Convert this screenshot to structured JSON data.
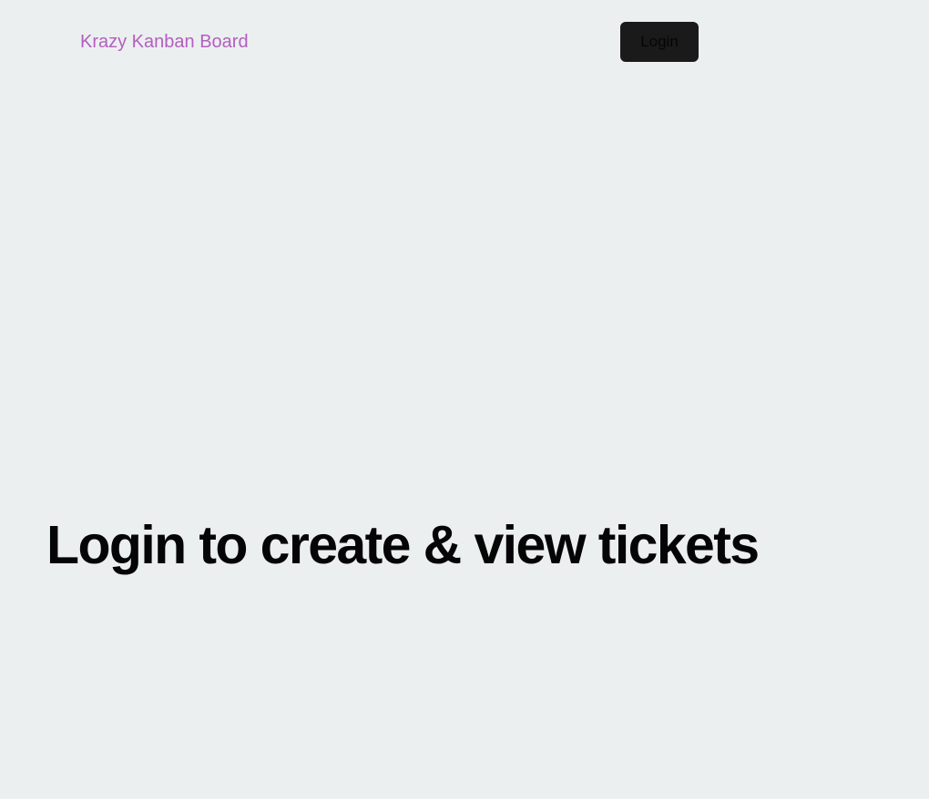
{
  "nav": {
    "brand": "Krazy Kanban Board",
    "login_label": "Login"
  },
  "main": {
    "heading": "Login to create & view tickets"
  },
  "colors": {
    "background": "#eceff0",
    "brand": "#b35fbf",
    "button_bg": "#1a1a1a",
    "heading": "#050505"
  }
}
